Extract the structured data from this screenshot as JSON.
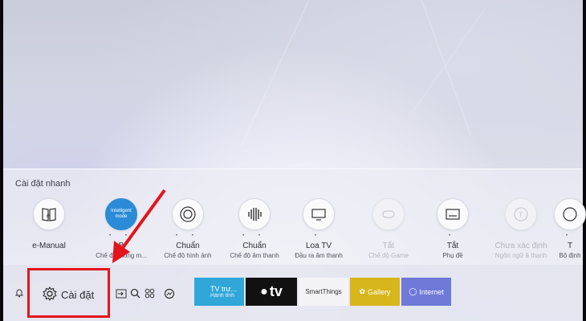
{
  "quick_settings": {
    "title": "Cài đặt nhanh",
    "items": [
      {
        "label": "e-Manual",
        "sub": "",
        "icon": "e-manual-icon"
      },
      {
        "label": "B",
        "sub": "Chế độ thông m...",
        "icon": "intelligent-mode-icon",
        "badge": "Intelligent mode"
      },
      {
        "label": "Chuẩn",
        "sub": "Chế độ hình ảnh",
        "icon": "picture-mode-icon"
      },
      {
        "label": "Chuẩn",
        "sub": "Chế độ âm thanh",
        "icon": "sound-mode-icon"
      },
      {
        "label": "Loa TV",
        "sub": "Đầu ra âm thanh",
        "icon": "tv-speaker-icon"
      },
      {
        "label": "Tắt",
        "sub": "Chế độ Game",
        "icon": "game-mode-icon",
        "disabled": true
      },
      {
        "label": "Tắt",
        "sub": "Phụ đề",
        "icon": "caption-icon"
      },
      {
        "label": "Chưa xác định",
        "sub": "Ngôn ngữ â thanh",
        "icon": "audio-language-icon",
        "disabled": true
      },
      {
        "label": "T",
        "sub": "Bộ định",
        "icon": "timer-icon"
      }
    ]
  },
  "bottom_bar": {
    "settings_label": "Cài đặt",
    "tiles": {
      "tv_title": "TV trự...",
      "tv_sub": "Hành tinh",
      "apple": "tv",
      "smartthings": "SmartThings",
      "gallery": "Gallery",
      "internet": "Internet"
    }
  },
  "colors": {
    "highlight": "#e3141c",
    "tv_tile": "#30a6d9",
    "apple_tile": "#111111",
    "gallery_tile": "#d7b61c",
    "internet_tile": "#6e79d8"
  }
}
